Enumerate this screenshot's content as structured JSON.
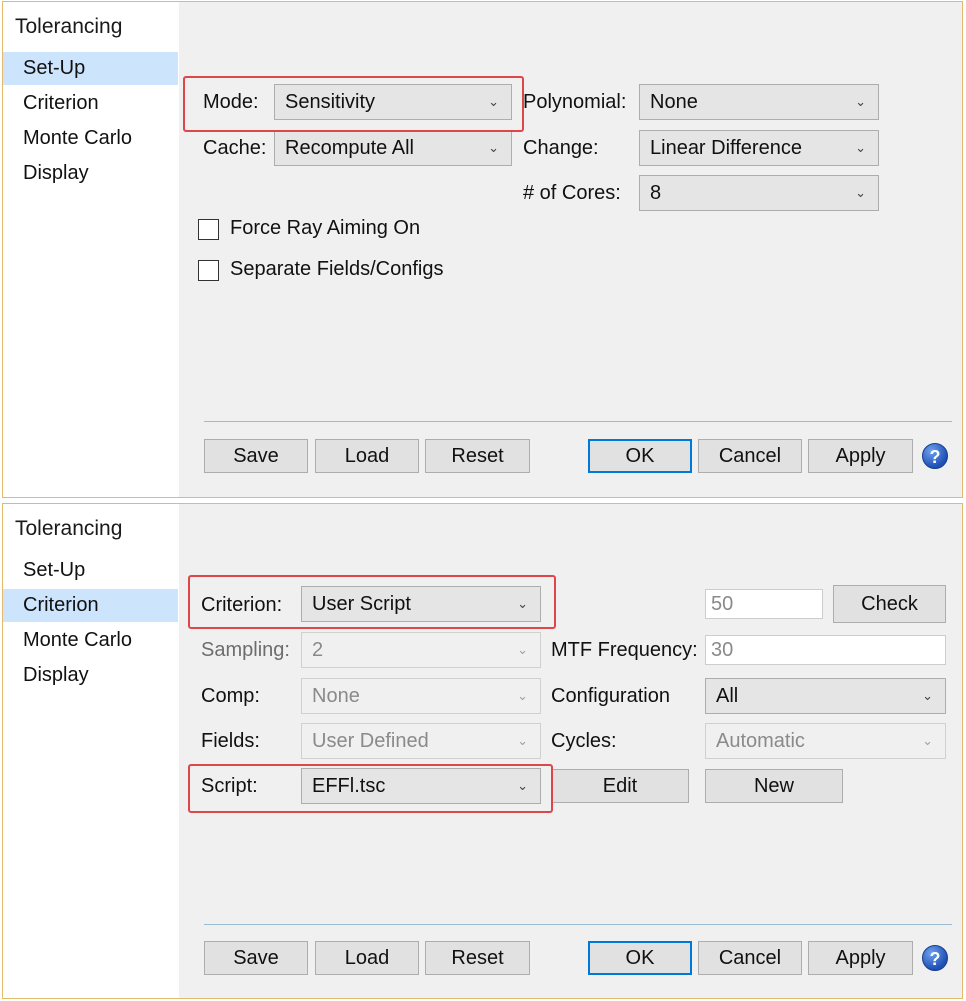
{
  "setup_panel": {
    "title": "Tolerancing",
    "nav": [
      "Set-Up",
      "Criterion",
      "Monte Carlo",
      "Display"
    ],
    "mode": {
      "label": "Mode:",
      "value": "Sensitivity"
    },
    "cache": {
      "label": "Cache:",
      "value": "Recompute All"
    },
    "polynomial": {
      "label": "Polynomial:",
      "value": "None"
    },
    "change": {
      "label": "Change:",
      "value": "Linear Difference"
    },
    "cores": {
      "label": "# of Cores:",
      "value": "8"
    },
    "force_ray_aiming": {
      "label": "Force Ray Aiming On",
      "checked": false
    },
    "separate_fields": {
      "label": "Separate Fields/Configs",
      "checked": false
    },
    "buttons": {
      "save": "Save",
      "load": "Load",
      "reset": "Reset",
      "ok": "OK",
      "cancel": "Cancel",
      "apply": "Apply"
    },
    "help": "?"
  },
  "criterion_panel": {
    "title": "Tolerancing",
    "nav": [
      "Set-Up",
      "Criterion",
      "Monte Carlo",
      "Display"
    ],
    "criterion": {
      "label": "Criterion:",
      "value": "User Script"
    },
    "threshold_value": "50",
    "check_button": "Check",
    "sampling": {
      "label": "Sampling:",
      "value": "2"
    },
    "mtf_frequency": {
      "label": "MTF Frequency:",
      "value": "30"
    },
    "comp": {
      "label": "Comp:",
      "value": "None"
    },
    "configuration": {
      "label": "Configuration",
      "value": "All"
    },
    "fields": {
      "label": "Fields:",
      "value": "User Defined"
    },
    "cycles": {
      "label": "Cycles:",
      "value": "Automatic"
    },
    "script": {
      "label": "Script:",
      "value": "EFFl.tsc"
    },
    "edit_button": "Edit",
    "new_button": "New",
    "buttons": {
      "save": "Save",
      "load": "Load",
      "reset": "Reset",
      "ok": "OK",
      "cancel": "Cancel",
      "apply": "Apply"
    },
    "help": "?"
  },
  "colors": {
    "highlight": "#e0454a",
    "selection": "#cce4fc",
    "default_button_border": "#0078d7",
    "panel_border": "#e3b96a"
  }
}
